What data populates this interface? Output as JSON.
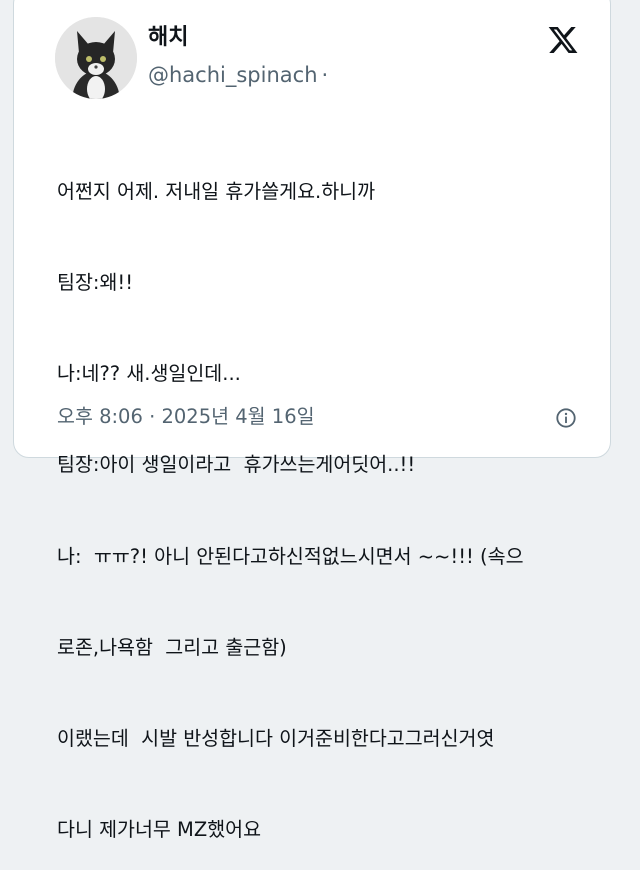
{
  "author": {
    "display_name": "해치",
    "handle": "@hachi_spinach",
    "separator": "·"
  },
  "tweet": {
    "lines": [
      "어쩐지 어제. 저내일 휴가쓸게요.하니까",
      "팀장:왜!!",
      "나:네?? 새.생일인데...",
      "팀장:아이 생일이라고  휴가쓰는게어딧어..!!",
      "나:  ㅠㅠ?! 아니 안된다고하신적없느시면서 ~~!!! (속으",
      "로존,나욕함  그리고 출근함)",
      "이랬는데  시발 반성합니다 이거준비한다고그러신거엿",
      "다니 제가너무 MZ했어요"
    ]
  },
  "meta": {
    "time": "오후 8:06",
    "dot": "·",
    "date": "2025년 4월 16일"
  },
  "icons": {
    "logo": "x-logo-icon",
    "info": "info-icon"
  },
  "colors": {
    "text": "#0f1419",
    "secondary": "#536471",
    "border": "#cfd9de"
  }
}
